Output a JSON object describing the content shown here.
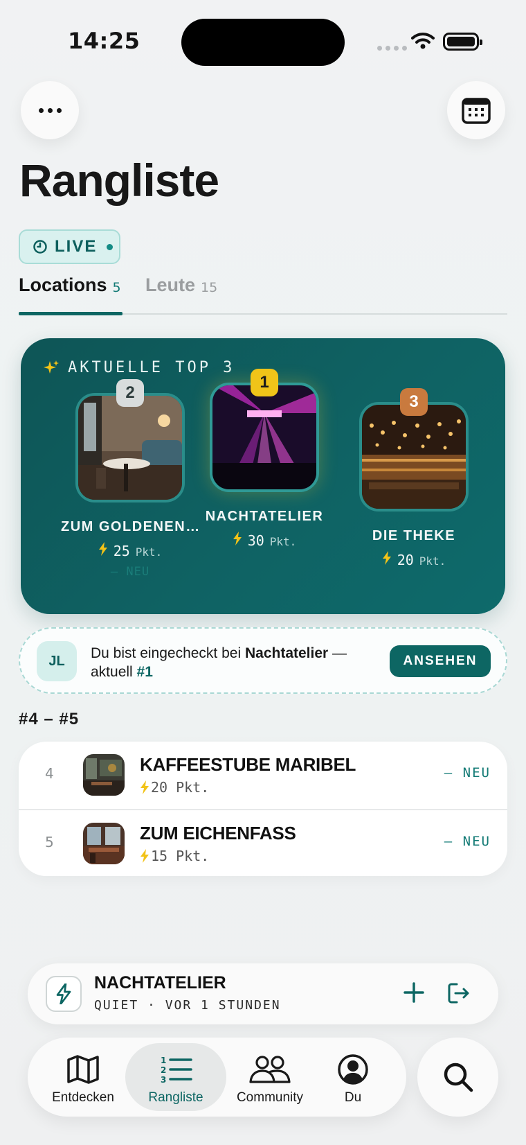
{
  "status_bar": {
    "time": "14:25"
  },
  "header": {
    "title": "Rangliste",
    "live_label": "LIVE"
  },
  "tabs": [
    {
      "label": "Locations",
      "count": "5",
      "active": true
    },
    {
      "label": "Leute",
      "count": "15",
      "active": false
    }
  ],
  "top3": {
    "title": "AKTUELLE TOP 3",
    "places": [
      {
        "rank": "2",
        "name": "ZUM GOLDENEN…",
        "points": "25",
        "unit": "Pkt.",
        "status": "— NEU"
      },
      {
        "rank": "1",
        "name": "NACHTATELIER",
        "points": "30",
        "unit": "Pkt."
      },
      {
        "rank": "3",
        "name": "DIE THEKE",
        "points": "20",
        "unit": "Pkt."
      }
    ]
  },
  "checkin": {
    "avatar_initials": "JL",
    "text_prefix": "Du bist eingecheckt bei ",
    "venue": "Nachtatelier",
    "text_mid": " —",
    "text_line2": "aktuell ",
    "rank": "#1",
    "button_label": "ANSEHEN"
  },
  "list_section": {
    "range_label": "#4 – #5",
    "rows": [
      {
        "rank": "4",
        "name": "KAFFEESTUBE MARIBEL",
        "points": "20 Pkt.",
        "status": "— NEU"
      },
      {
        "rank": "5",
        "name": "ZUM EICHENFASS",
        "points": "15 Pkt.",
        "status": "— NEU"
      }
    ]
  },
  "now_bar": {
    "title": "NACHTATELIER",
    "subtitle": "QUIET · VOR 1 STUNDEN"
  },
  "nav": [
    {
      "label": "Entdecken",
      "icon": "map-icon"
    },
    {
      "label": "Rangliste",
      "icon": "ranked-list-icon",
      "active": true
    },
    {
      "label": "Community",
      "icon": "people-icon"
    },
    {
      "label": "Du",
      "icon": "profile-icon"
    }
  ],
  "colors": {
    "accent": "#0d6663",
    "card_teal": "#0f6263",
    "gold": "#f0c419",
    "silver": "#d8dcdc",
    "bronze": "#c97a3e",
    "bolt": "#f2c318"
  }
}
